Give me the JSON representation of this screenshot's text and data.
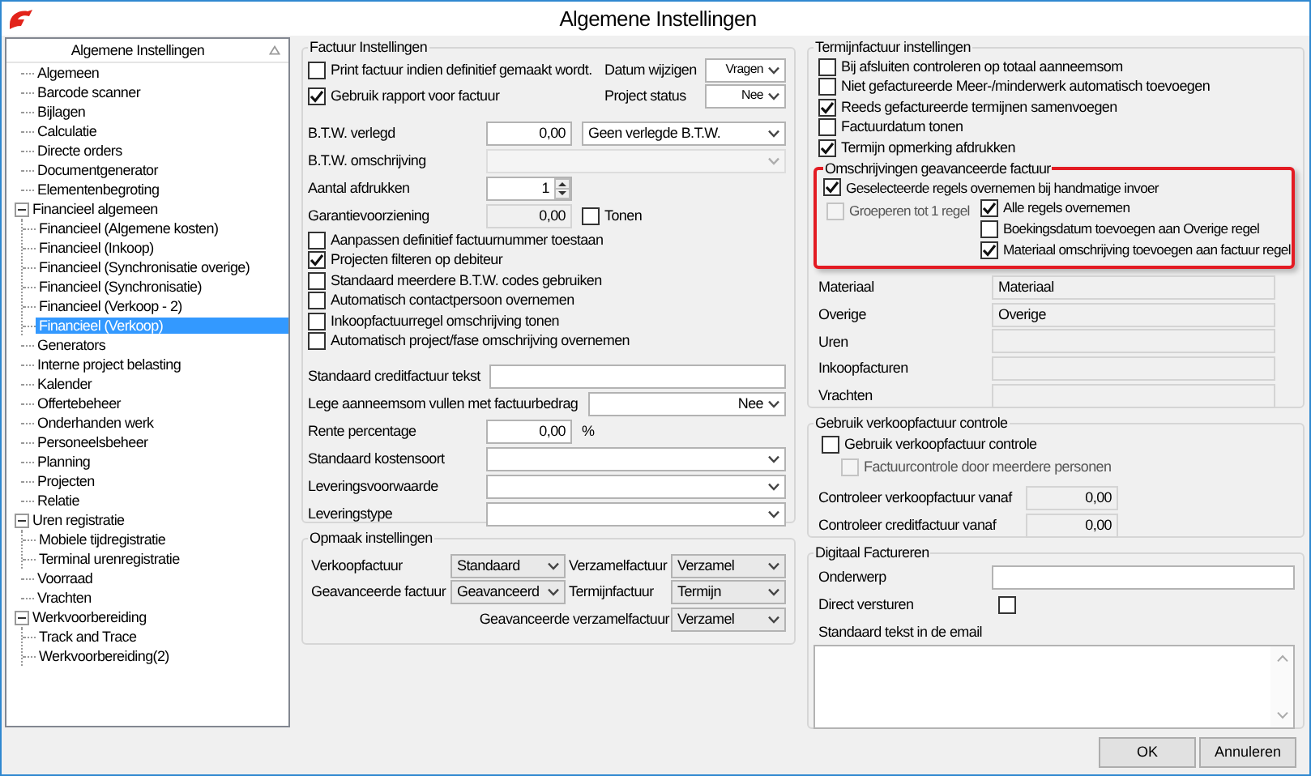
{
  "window": {
    "title": "Algemene Instellingen"
  },
  "tree": {
    "header": "Algemene Instellingen",
    "items": [
      {
        "label": "Algemeen",
        "selected": false
      },
      {
        "label": "Barcode scanner",
        "selected": false
      },
      {
        "label": "Bijlagen",
        "selected": false
      },
      {
        "label": "Calculatie",
        "selected": false
      },
      {
        "label": "Directe orders",
        "selected": false
      },
      {
        "label": "Documentgenerator",
        "selected": false
      },
      {
        "label": "Elementenbegroting",
        "selected": false
      },
      {
        "label": "Financieel algemeen",
        "selected": false,
        "expanded": true,
        "children": [
          {
            "label": "Financieel (Algemene kosten)",
            "selected": false
          },
          {
            "label": "Financieel (Inkoop)",
            "selected": false
          },
          {
            "label": "Financieel (Synchronisatie overige)",
            "selected": false
          },
          {
            "label": "Financieel (Synchronisatie)",
            "selected": false
          },
          {
            "label": "Financieel (Verkoop - 2)",
            "selected": false
          },
          {
            "label": "Financieel (Verkoop)",
            "selected": true
          }
        ]
      },
      {
        "label": "Generators",
        "selected": false
      },
      {
        "label": "Interne project belasting",
        "selected": false
      },
      {
        "label": "Kalender",
        "selected": false
      },
      {
        "label": "Offertebeheer",
        "selected": false
      },
      {
        "label": "Onderhanden werk",
        "selected": false
      },
      {
        "label": "Personeelsbeheer",
        "selected": false
      },
      {
        "label": "Planning",
        "selected": false
      },
      {
        "label": "Projecten",
        "selected": false
      },
      {
        "label": "Relatie",
        "selected": false
      },
      {
        "label": "Uren registratie",
        "selected": false,
        "expanded": true,
        "children": [
          {
            "label": "Mobiele tijdregistratie",
            "selected": false
          },
          {
            "label": "Terminal urenregistratie",
            "selected": false
          }
        ]
      },
      {
        "label": "Voorraad",
        "selected": false
      },
      {
        "label": "Vrachten",
        "selected": false
      },
      {
        "label": "Werkvoorbereiding",
        "selected": false,
        "expanded": true,
        "children": [
          {
            "label": "Track and Trace",
            "selected": false
          },
          {
            "label": "Werkvoorbereiding(2)",
            "selected": false
          }
        ]
      }
    ]
  },
  "factuur": {
    "title": "Factuur Instellingen",
    "rows": [
      {
        "kind": "check",
        "text": "Print factuur indien definitief gemaakt wordt.",
        "checked": false,
        "caption": "Datum wijzigen",
        "choice": "Vragen"
      },
      {
        "kind": "check",
        "text": "Gebruik rapport voor factuur",
        "checked": true,
        "caption": "Project status",
        "choice": "Nee"
      },
      {
        "kind": "field",
        "label": "B.T.W. verlegd",
        "controls": [
          {
            "kind": "number",
            "value": "0,00"
          },
          {
            "kind": "select",
            "value": "Geen verlegde B.T.W."
          }
        ]
      },
      {
        "kind": "field",
        "label": "B.T.W. omschrijving",
        "controls": [
          {
            "kind": "select-disabled"
          }
        ]
      },
      {
        "kind": "field",
        "label": "Aantal afdrukken",
        "controls": [
          {
            "kind": "spin",
            "value": "1"
          }
        ]
      },
      {
        "kind": "field",
        "label": "Garantievoorziening",
        "controls": [
          {
            "kind": "number-readonly",
            "value": "0,00"
          },
          {
            "kind": "check",
            "text": "Tonen",
            "checked": false
          }
        ]
      },
      {
        "kind": "check",
        "text": "Aanpassen definitief factuurnummer toestaan",
        "checked": false
      },
      {
        "kind": "check",
        "text": "Projecten filteren op debiteur",
        "checked": true
      },
      {
        "kind": "check",
        "text": "Standaard meerdere B.T.W. codes gebruiken",
        "checked": false
      },
      {
        "kind": "check",
        "text": "Automatisch contactpersoon overnemen",
        "checked": false
      },
      {
        "kind": "check",
        "text": "Inkoopfactuurregel omschrijving tonen",
        "checked": false
      },
      {
        "kind": "check",
        "text": "Automatisch project/fase omschrijving overnemen",
        "checked": false
      },
      {
        "kind": "field",
        "label": "Standaard creditfactuur tekst",
        "controls": [
          {
            "kind": "text"
          }
        ]
      },
      {
        "kind": "field",
        "label": "Lege aanneemsom vullen met factuurbedrag",
        "controls": [
          {
            "kind": "choice",
            "value": "Nee"
          }
        ]
      },
      {
        "kind": "field",
        "label": "Rente percentage",
        "controls": [
          {
            "kind": "number",
            "value": "0,00"
          },
          {
            "kind": "unit",
            "value": "%"
          }
        ]
      },
      {
        "kind": "field",
        "label": "Standaard kostensoort",
        "controls": [
          {
            "kind": "select"
          }
        ]
      },
      {
        "kind": "field",
        "label": "Leveringsvoorwaarde",
        "controls": [
          {
            "kind": "select"
          }
        ]
      },
      {
        "kind": "field",
        "label": "Leveringstype",
        "controls": [
          {
            "kind": "select"
          }
        ]
      }
    ]
  },
  "opmaak": {
    "title": "Opmaak instellingen",
    "rows": [
      {
        "pairs": [
          {
            "label": "Verkoopfactuur",
            "value": "Standaard"
          },
          {
            "label": "Verzamelfactuur",
            "value": "Verzamel"
          }
        ]
      },
      {
        "pairs": [
          {
            "label": "Geavanceerde factuur",
            "value": "Geavanceerd"
          },
          {
            "label": "Termijnfactuur",
            "value": "Termijn"
          }
        ]
      },
      {
        "pairs": [
          {
            "label": "Geavanceerde verzamelfactuur",
            "value": "Verzamel"
          }
        ]
      }
    ]
  },
  "termijn": {
    "title": "Termijnfactuur instellingen",
    "checks": [
      {
        "text": "Bij afsluiten controleren op totaal aanneemsom",
        "checked": false
      },
      {
        "text": "Niet gefactureerde Meer-/minderwerk automatisch toevoegen",
        "checked": false
      },
      {
        "text": "Reeds gefactureerde termijnen samenvoegen",
        "checked": true
      },
      {
        "text": "Factuurdatum tonen",
        "checked": false
      },
      {
        "text": "Termijn opmerking afdrukken",
        "checked": true
      }
    ],
    "omschrijvingen": {
      "title": "Omschrijvingen geavanceerde factuur",
      "highlighted": true,
      "main": {
        "text": "Geselecteerde regels overnemen bij handmatige invoer",
        "checked": true,
        "disabled": false
      },
      "left": {
        "text": "Groeperen tot 1 regel",
        "checked": false,
        "disabled": true
      },
      "right": [
        {
          "text": "Alle regels overnemen",
          "checked": true,
          "disabled": false
        },
        {
          "text": "Boekingsdatum toevoegen aan Overige regel",
          "checked": false,
          "disabled": false
        },
        {
          "text": "Materiaal omschrijving toevoegen aan factuur regel",
          "checked": true,
          "disabled": false
        }
      ]
    },
    "fields": [
      {
        "label": "Materiaal",
        "value": "Materiaal"
      },
      {
        "label": "Overige",
        "value": "Overige"
      },
      {
        "label": "Uren"
      },
      {
        "label": "Inkoopfacturen"
      },
      {
        "label": "Vrachten"
      }
    ]
  },
  "controle": {
    "title": "Gebruik verkoopfactuur controle",
    "checks": [
      {
        "text": "Gebruik verkoopfactuur controle",
        "checked": false,
        "disabled": false,
        "children": [
          {
            "text": "Factuurcontrole door meerdere personen",
            "checked": false,
            "disabled": true
          }
        ]
      }
    ],
    "fields": [
      {
        "label": "Controleer verkoopfactuur vanaf",
        "value": "0,00"
      },
      {
        "label": "Controleer creditfactuur vanaf",
        "value": "0,00"
      }
    ]
  },
  "digitaal": {
    "title": "Digitaal Factureren",
    "subject_label": "Onderwerp",
    "direct_label": "Direct versturen",
    "direct_checked": false,
    "email_label": "Standaard tekst in de email"
  },
  "buttons": [
    "OK",
    "Annuleren"
  ]
}
